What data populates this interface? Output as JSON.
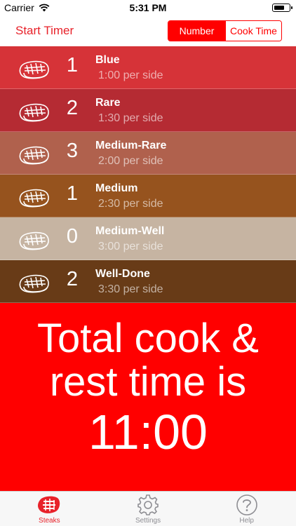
{
  "status_bar": {
    "carrier": "Carrier",
    "time": "5:31 PM",
    "battery_level": 0.7
  },
  "nav": {
    "start_timer_label": "Start Timer",
    "segments": [
      {
        "label": "Number",
        "selected": true
      },
      {
        "label": "Cook Time",
        "selected": false
      }
    ]
  },
  "steaks": [
    {
      "count": "1",
      "name": "Blue",
      "time": "1:00 per side",
      "color": "#d63338"
    },
    {
      "count": "2",
      "name": "Rare",
      "time": "1:30 per side",
      "color": "#b52b33"
    },
    {
      "count": "3",
      "name": "Medium-Rare",
      "time": "2:00 per side",
      "color": "#b0614d"
    },
    {
      "count": "1",
      "name": "Medium",
      "time": "2:30 per side",
      "color": "#96531e"
    },
    {
      "count": "0",
      "name": "Medium-Well",
      "time": "3:00 per side",
      "color": "#c6b4a2"
    },
    {
      "count": "2",
      "name": "Well-Done",
      "time": "3:30 per side",
      "color": "#683b17"
    }
  ],
  "total": {
    "line1": "Total cook &",
    "line2": "rest time is",
    "time": "11:00"
  },
  "tabs": [
    {
      "label": "Steaks",
      "icon": "steak-icon",
      "active": true
    },
    {
      "label": "Settings",
      "icon": "gear-icon",
      "active": false
    },
    {
      "label": "Help",
      "icon": "help-icon",
      "active": false
    }
  ],
  "colors": {
    "accent": "#ff0000",
    "accent_text": "#e8222a",
    "tab_inactive": "#8e8e93"
  }
}
